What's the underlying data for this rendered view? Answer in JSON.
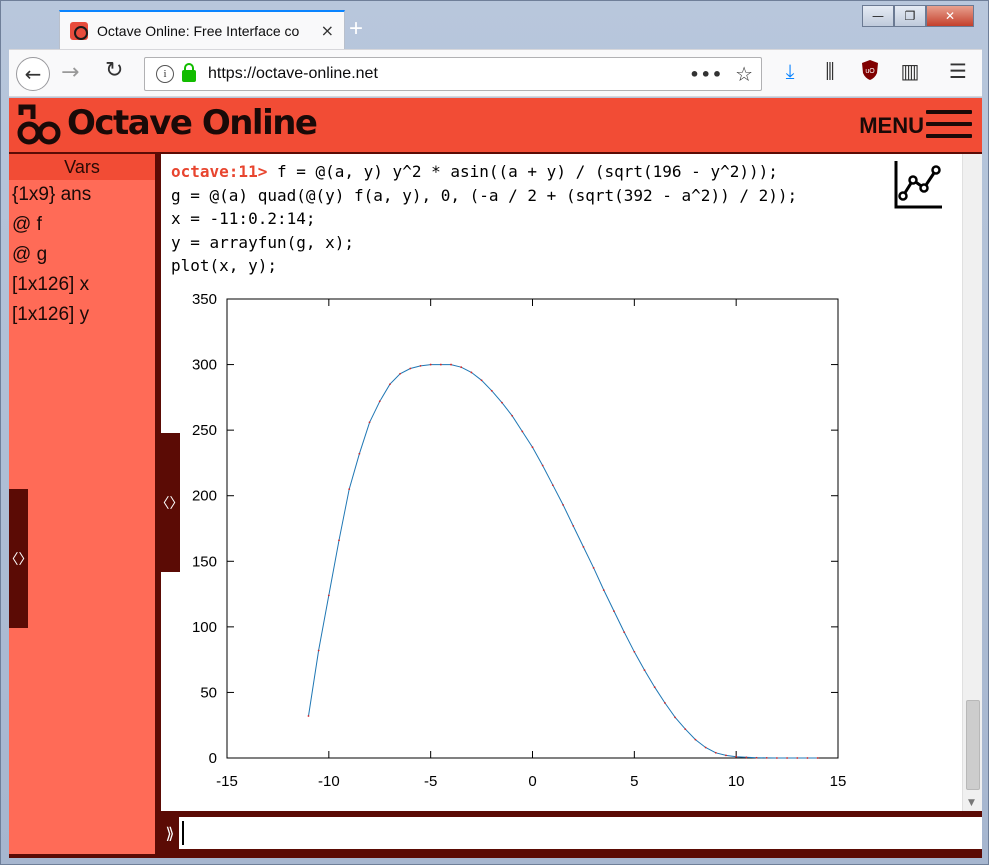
{
  "browser": {
    "tab_title": "Octave Online: Free Interface co",
    "tab_close": "×",
    "new_tab": "+",
    "url": "https://octave-online.net",
    "url_more": "•••",
    "window_min": "—",
    "window_max": "❐",
    "window_close": "✕"
  },
  "app": {
    "logo_text": "Octave Online",
    "menu_label": "MENU",
    "brand_color": "#f24c35",
    "dark_color": "#5b0b05"
  },
  "vars": {
    "title": "Vars",
    "items": [
      {
        "label": "{1x9} ans"
      },
      {
        "label": "@ f"
      },
      {
        "label": "@ g"
      },
      {
        "label": "[1x126] x"
      },
      {
        "label": "[1x126] y"
      }
    ],
    "toggle": "〈〉"
  },
  "console": {
    "prompt": "octave:11>",
    "lines": [
      " f = @(a, y) y^2 * asin((a + y) / (sqrt(196 - y^2)));",
      "g = @(a) quad(@(y) f(a, y), 0, (-a / 2 + (sqrt(392 - a^2)) / 2));",
      "x = -11:0.2:14;",
      "y = arrayfun(g, x);",
      "plot(x, y);"
    ],
    "toggle": "〈〉",
    "input_prompt": "⟫",
    "input_value": ""
  },
  "chart_data": {
    "type": "line",
    "xlim": [
      -15,
      15
    ],
    "ylim": [
      0,
      350
    ],
    "xticks": [
      "-15",
      "-10",
      "-5",
      "0",
      "5",
      "10",
      "15"
    ],
    "yticks": [
      "0",
      "50",
      "100",
      "150",
      "200",
      "250",
      "300",
      "350"
    ],
    "grid": false,
    "series": [
      {
        "color": "#1f77b4",
        "marker_color": "#d62728",
        "x": [
          -11,
          -10.5,
          -10,
          -9.5,
          -9,
          -8.5,
          -8,
          -7.5,
          -7,
          -6.5,
          -6,
          -5.5,
          -5,
          -4.5,
          -4,
          -3.5,
          -3,
          -2.5,
          -2,
          -1.5,
          -1,
          -0.5,
          0,
          0.5,
          1,
          1.5,
          2,
          2.5,
          3,
          3.5,
          4,
          4.5,
          5,
          5.5,
          6,
          6.5,
          7,
          7.5,
          8,
          8.5,
          9,
          9.5,
          10,
          10.5,
          11,
          11.5,
          12,
          12.5,
          13,
          13.5,
          14
        ],
        "y": [
          32,
          82,
          124,
          166,
          205,
          232,
          256,
          272,
          285,
          293,
          297,
          299,
          300,
          300,
          300,
          298,
          294,
          288,
          280,
          271,
          261,
          249,
          237,
          223,
          208,
          193,
          177,
          161,
          145,
          128,
          112,
          96,
          81,
          67,
          54,
          42,
          31,
          22,
          14,
          8,
          4,
          2,
          1,
          0.5,
          0.2,
          0.1,
          0,
          0,
          0,
          0,
          0
        ]
      }
    ]
  }
}
